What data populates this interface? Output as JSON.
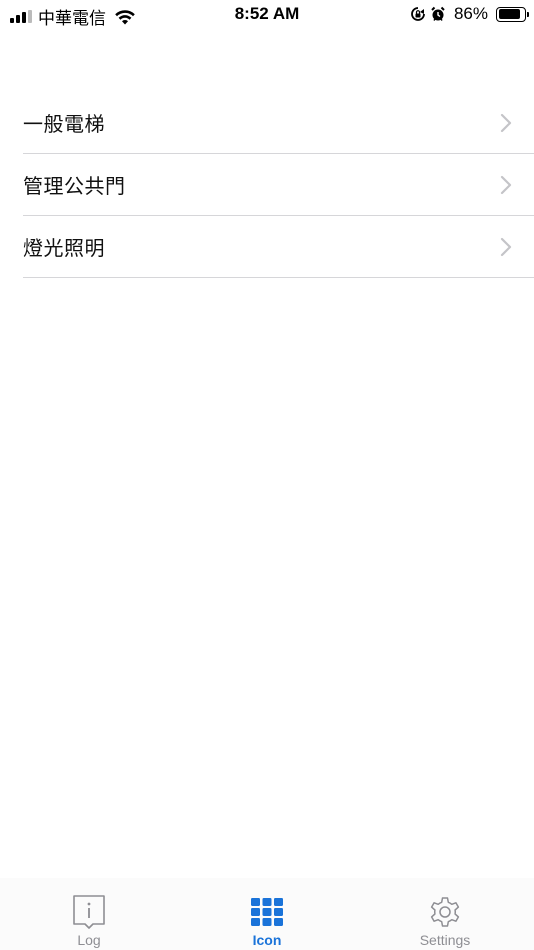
{
  "status_bar": {
    "carrier": "中華電信",
    "time": "8:52 AM",
    "battery_percent": "86%",
    "battery_level": 0.86,
    "icons": [
      "signal-icon",
      "wifi-icon",
      "rotation-lock-icon",
      "alarm-icon",
      "battery-icon"
    ]
  },
  "menu": {
    "items": [
      {
        "label": "一般電梯",
        "icon": "chevron-right-icon"
      },
      {
        "label": "管理公共門",
        "icon": "chevron-right-icon"
      },
      {
        "label": "燈光照明",
        "icon": "chevron-right-icon"
      }
    ]
  },
  "tab_bar": {
    "tabs": [
      {
        "label": "Log",
        "icon": "info-book-icon",
        "active": false
      },
      {
        "label": "Icon",
        "icon": "grid-icon",
        "active": true
      },
      {
        "label": "Settings",
        "icon": "gear-icon",
        "active": false
      }
    ]
  },
  "colors": {
    "accent": "#1a73d9",
    "inactive": "#8e8e93",
    "separator": "#d6d6d9",
    "chevron": "#c4c4c8"
  }
}
